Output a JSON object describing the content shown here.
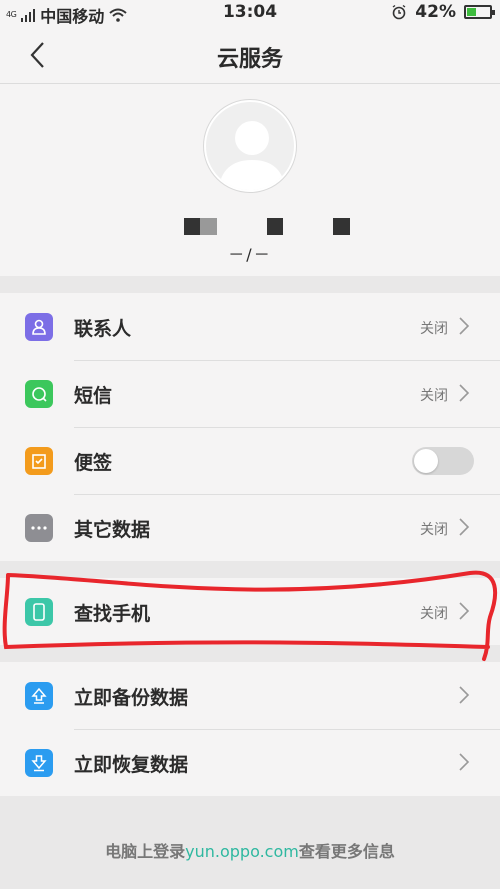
{
  "status_bar": {
    "network": "4G",
    "carrier": "中国移动",
    "time": "13:04",
    "battery_percent": "42%",
    "battery_level": 0.42,
    "icons": [
      "signal-icon",
      "wifi-icon",
      "alarm-icon",
      "battery-charging-icon"
    ]
  },
  "nav": {
    "title": "云服务",
    "back_icon": "back-chevron-icon"
  },
  "profile": {
    "account": "－/－"
  },
  "sync_items": [
    {
      "label": "联系人",
      "status": "关闭",
      "icon": "contacts-icon",
      "color": "#7c6ee6"
    },
    {
      "label": "短信",
      "status": "关闭",
      "icon": "message-icon",
      "color": "#3cc75c"
    },
    {
      "label": "便签",
      "icon": "note-icon",
      "color": "#f39b1c",
      "toggle_on": false
    },
    {
      "label": "其它数据",
      "status": "关闭",
      "icon": "more-icon",
      "color": "#8e8e93"
    }
  ],
  "find_phone": {
    "label": "查找手机",
    "status": "关闭",
    "icon": "phone-icon",
    "color": "#3cc7a8"
  },
  "actions": [
    {
      "label": "立即备份数据",
      "icon": "upload-icon",
      "color": "#2b9cf0"
    },
    {
      "label": "立即恢复数据",
      "icon": "download-icon",
      "color": "#2b9cf0"
    }
  ],
  "footer": {
    "prefix": "电脑上登录",
    "link": "yun.oppo.com",
    "suffix": "查看更多信息"
  },
  "annotation_color": "#e8262c"
}
